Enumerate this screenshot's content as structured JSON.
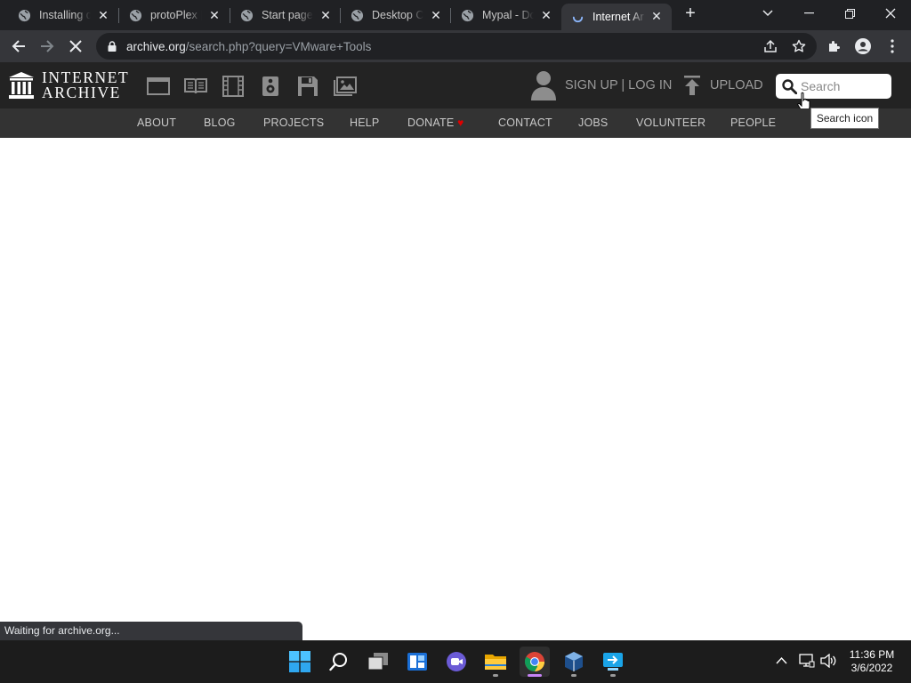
{
  "browser": {
    "tabs": [
      {
        "title": "Installing d",
        "active": false
      },
      {
        "title": "protoPlex |",
        "active": false
      },
      {
        "title": "Start page",
        "active": false
      },
      {
        "title": "Desktop Co",
        "active": false
      },
      {
        "title": "Mypal - Do",
        "active": false
      },
      {
        "title": "Internet Ar",
        "active": true
      }
    ],
    "url_host": "archive.org",
    "url_path": "/search.php?query=VMware+Tools",
    "status_text": "Waiting for archive.org..."
  },
  "site": {
    "logo_line1": "INTERNET",
    "logo_line2": "ARCHIVE",
    "signup_login": "SIGN UP | LOG IN",
    "upload": "UPLOAD",
    "search_placeholder": "Search",
    "tooltip": "Search icon",
    "nav": [
      "ABOUT",
      "BLOG",
      "PROJECTS",
      "HELP",
      "DONATE",
      "CONTACT",
      "JOBS",
      "VOLUNTEER",
      "PEOPLE"
    ]
  },
  "taskbar": {
    "time": "11:36 PM",
    "date": "3/6/2022"
  },
  "colors": {
    "tabstrip": "#202124",
    "toolbar": "#35363a",
    "ia_header": "#232323",
    "ia_nav": "#333333",
    "donate_heart": "#e00000",
    "taskbar": "#1c1c1c"
  }
}
